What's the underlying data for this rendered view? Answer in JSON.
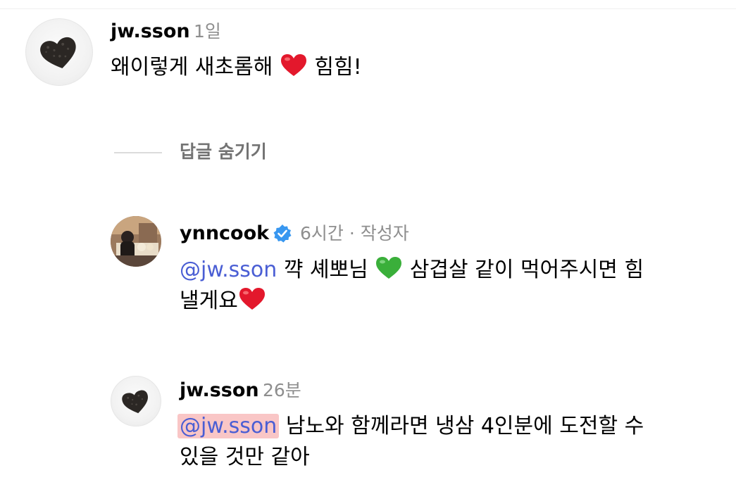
{
  "comments": [
    {
      "username": "jw.sson",
      "time": "1일",
      "text_before": "왜이렇게 새초롬해 ",
      "emoji": "red-heart",
      "text_after": " 힘힘!"
    }
  ],
  "hide_replies_label": "답글 숨기기",
  "replies": [
    {
      "username": "ynncook",
      "verified": true,
      "meta": "6시간 · 작성자",
      "mention": "@jw.sson",
      "line1_text": " 꺅 셰뽀님 ",
      "emoji_mid": "green-heart",
      "line1_text_after": " 삼겹살 같이 먹어주시면 힘",
      "line2_text": "낼게요",
      "emoji_end": "red-heart"
    },
    {
      "username": "jw.sson",
      "time": "26분",
      "mention": "@jw.sson",
      "line1_text": " 남노와 함께라면 냉삼 4인분에 도전할 수",
      "line2_text": "있을 것만 같아"
    }
  ],
  "colors": {
    "mention": "#4a5ed4",
    "meta": "#8e8e8e",
    "highlight": "#f9c6c6",
    "verified": "#3897f0",
    "heart_red": "#e3182c",
    "heart_green": "#3aaf3a"
  }
}
